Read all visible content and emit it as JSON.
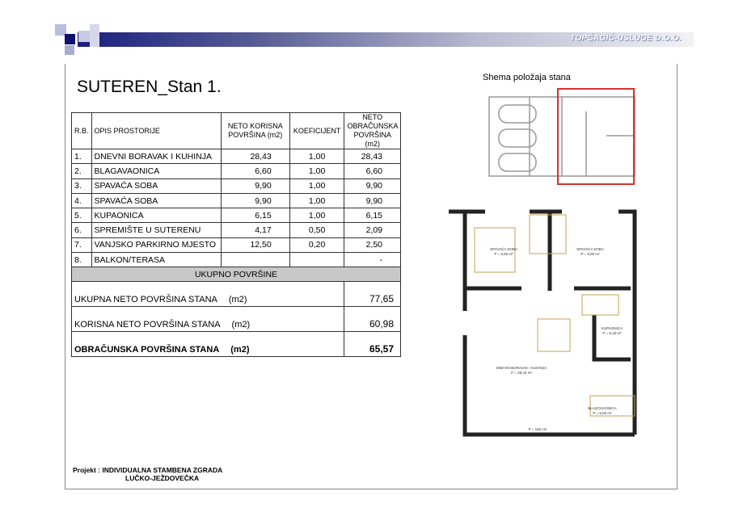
{
  "header": {
    "company_logo": "TOPĆAGIĆ-USLUGE D.O.O."
  },
  "page_title": "SUTEREN_Stan 1.",
  "table": {
    "headers": [
      "R.B.",
      "OPIS PROSTORIJE",
      "NETO KORISNA POVRŠINA (m2)",
      "KOEFICIJENT",
      "NETO OBRAČUNSKA POVRŠINA (m2)"
    ],
    "rows": [
      {
        "rb": "1.",
        "opis": "DNEVNI BORAVAK I KUHINJA",
        "neto": "28,43",
        "koef": "1,00",
        "obr": "28,43"
      },
      {
        "rb": "2.",
        "opis": "BLAGAVAONICA",
        "neto": "6,60",
        "koef": "1,00",
        "obr": "6,60"
      },
      {
        "rb": "3.",
        "opis": "SPAVAĆA SOBA",
        "neto": "9,90",
        "koef": "1,00",
        "obr": "9,90"
      },
      {
        "rb": "4.",
        "opis": "SPAVAĆA SOBA",
        "neto": "9,90",
        "koef": "1,00",
        "obr": "9,90"
      },
      {
        "rb": "5.",
        "opis": "KUPAONICA",
        "neto": "6,15",
        "koef": "1,00",
        "obr": "6,15"
      },
      {
        "rb": "6.",
        "opis": "SPREMIŠTE U SUTERENU",
        "neto": "4,17",
        "koef": "0,50",
        "obr": "2,09"
      },
      {
        "rb": "7.",
        "opis": "VANJSKO PARKIRNO MJESTO",
        "neto": "12,50",
        "koef": "0,20",
        "obr": "2,50"
      },
      {
        "rb": "8.",
        "opis": "BALKON/TERASA",
        "neto": "",
        "koef": "",
        "obr": "-"
      }
    ],
    "total_heading": "UKUPNO POVRŠINE",
    "summary": [
      {
        "label": "UKUPNA NETO POVRŠINA STANA",
        "unit": "(m2)",
        "value": "77,65"
      },
      {
        "label": "KORISNA NETO POVRŠINA STANA",
        "unit": "(m2)",
        "value": "60,98"
      },
      {
        "label": "OBRAČUNSKA POVRŠINA STANA",
        "unit": "(m2)",
        "value": "65,57"
      }
    ]
  },
  "schema": {
    "title": "Shema položaja stana",
    "highlight_color": "#d9302a"
  },
  "floorplan": {
    "rooms": [
      {
        "name": "SPAVAĆA SOBA",
        "area": "P = 9,90 m²"
      },
      {
        "name": "SPAVAĆA SOBA",
        "area": "P = 9,90 m²"
      },
      {
        "name": "KUPAONICA",
        "area": "P = 6,15 m²"
      },
      {
        "name": "DNEVNI BORAVAK I KUHINJA",
        "area": "P = 28,43 m²"
      },
      {
        "name": "BLAGOVAONICA",
        "area": "P = 6,60 m²"
      }
    ],
    "window_label": "P = 160 cm"
  },
  "project": {
    "line1": "Projekt : INDIVIDUALNA STAMBENA ZGRADA",
    "line2": "LUČKO-JEŽDOVEČKA"
  }
}
